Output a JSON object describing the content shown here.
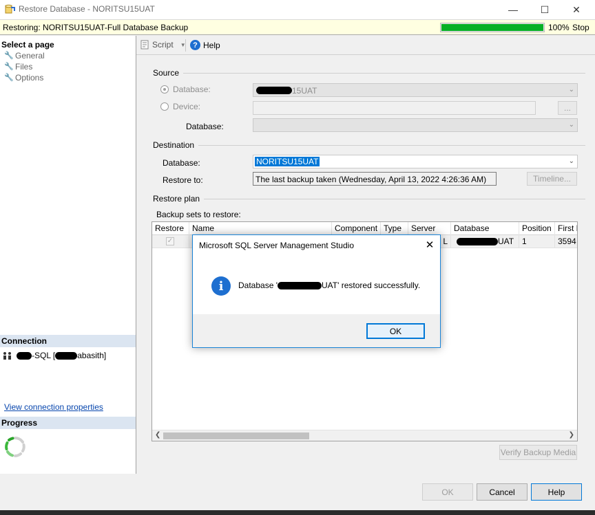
{
  "window": {
    "title": "Restore Database - NORITSU15UAT",
    "minimize_glyph": "—",
    "maximize_glyph": "☐",
    "close_glyph": "✕"
  },
  "status": {
    "text": "Restoring: NORITSU15UAT-Full Database Backup",
    "progress_value": 100,
    "progress_label": "100%",
    "stop_label": "Stop",
    "accent": "#06b025"
  },
  "left": {
    "select_page_header": "Select a page",
    "pages": [
      {
        "label": "General"
      },
      {
        "label": "Files"
      },
      {
        "label": "Options"
      }
    ],
    "connection_header": "Connection",
    "connection_prefix": "-SQL [",
    "connection_suffix": "abasith]",
    "view_connection_link": "View connection properties",
    "progress_header": "Progress"
  },
  "toolbar": {
    "script_label": "Script",
    "help_label": "Help"
  },
  "source": {
    "header": "Source",
    "database_radio_label": "Database:",
    "database_value_suffix": "15UAT",
    "device_radio_label": "Device:",
    "browse_label": "...",
    "database_label": "Database:"
  },
  "destination": {
    "header": "Destination",
    "database_label": "Database:",
    "database_value": "NORITSU15UAT",
    "restore_to_label": "Restore to:",
    "restore_to_value": "The last backup taken (Wednesday, April 13, 2022 4:26:36 AM)",
    "timeline_label": "Timeline..."
  },
  "plan": {
    "header": "Restore plan",
    "backup_sets_label": "Backup sets to restore:",
    "columns": [
      "Restore",
      "Name",
      "Component",
      "Type",
      "Server",
      "Database",
      "Position",
      "First L"
    ],
    "row": {
      "server_tail": "L",
      "database_suffix": "UAT",
      "position": "1",
      "first_lsn": "3594"
    },
    "verify_label": "Verify Backup Media"
  },
  "dialog": {
    "title": "Microsoft SQL Server Management Studio",
    "close_glyph": "✕",
    "icon_glyph": "i",
    "message_prefix": "Database '",
    "message_suffix": "UAT' restored successfully.",
    "ok_label": "OK"
  },
  "buttons": {
    "ok": "OK",
    "cancel": "Cancel",
    "help": "Help"
  }
}
